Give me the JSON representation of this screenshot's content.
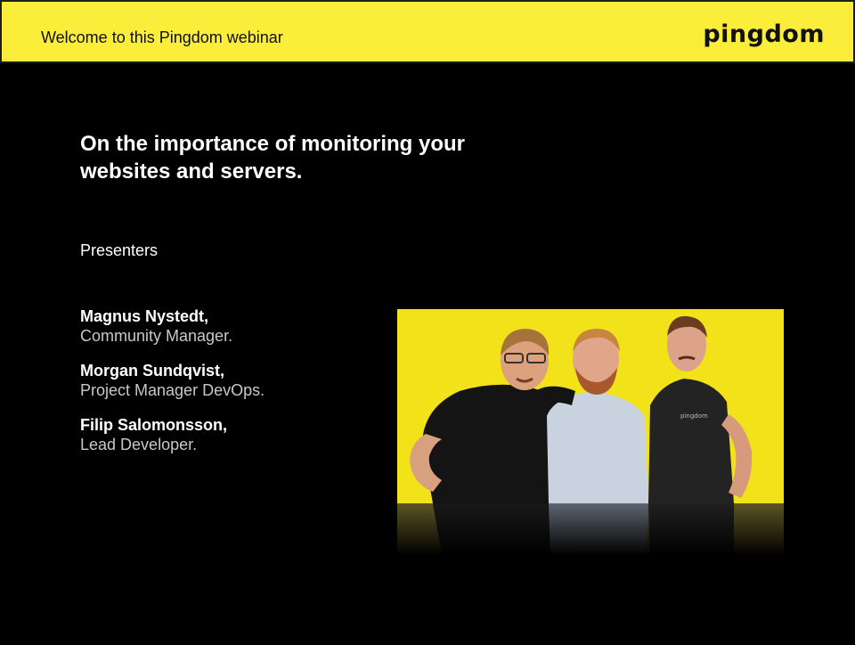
{
  "header": {
    "welcome_text": "Welcome to this Pingdom webinar",
    "logo_text": "pingdom"
  },
  "title": {
    "line1": "On the importance of monitoring your",
    "line2": "websites and servers."
  },
  "presenters_label": "Presenters",
  "presenters": [
    {
      "name": "Magnus Nystedt,",
      "role": "Community Manager."
    },
    {
      "name": "Morgan Sundqvist,",
      "role": "Project Manager DevOps."
    },
    {
      "name": "Filip Salomonsson,",
      "role": "Lead Developer."
    }
  ],
  "photo": {
    "shirt_logo_text": "pingdom"
  },
  "colors": {
    "header_yellow": "#fbee3b",
    "background": "#000000",
    "photo_yellow": "#f2e21a"
  }
}
